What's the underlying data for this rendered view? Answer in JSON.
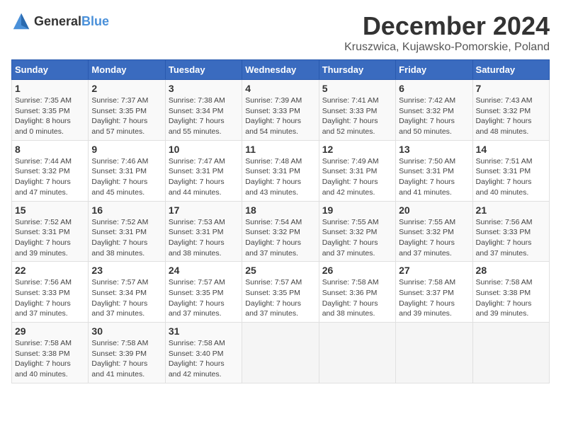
{
  "logo": {
    "text_general": "General",
    "text_blue": "Blue"
  },
  "title": "December 2024",
  "location": "Kruszwica, Kujawsko-Pomorskie, Poland",
  "weekdays": [
    "Sunday",
    "Monday",
    "Tuesday",
    "Wednesday",
    "Thursday",
    "Friday",
    "Saturday"
  ],
  "weeks": [
    [
      {
        "day": "1",
        "detail": "Sunrise: 7:35 AM\nSunset: 3:35 PM\nDaylight: 8 hours\nand 0 minutes."
      },
      {
        "day": "2",
        "detail": "Sunrise: 7:37 AM\nSunset: 3:35 PM\nDaylight: 7 hours\nand 57 minutes."
      },
      {
        "day": "3",
        "detail": "Sunrise: 7:38 AM\nSunset: 3:34 PM\nDaylight: 7 hours\nand 55 minutes."
      },
      {
        "day": "4",
        "detail": "Sunrise: 7:39 AM\nSunset: 3:33 PM\nDaylight: 7 hours\nand 54 minutes."
      },
      {
        "day": "5",
        "detail": "Sunrise: 7:41 AM\nSunset: 3:33 PM\nDaylight: 7 hours\nand 52 minutes."
      },
      {
        "day": "6",
        "detail": "Sunrise: 7:42 AM\nSunset: 3:32 PM\nDaylight: 7 hours\nand 50 minutes."
      },
      {
        "day": "7",
        "detail": "Sunrise: 7:43 AM\nSunset: 3:32 PM\nDaylight: 7 hours\nand 48 minutes."
      }
    ],
    [
      {
        "day": "8",
        "detail": "Sunrise: 7:44 AM\nSunset: 3:32 PM\nDaylight: 7 hours\nand 47 minutes."
      },
      {
        "day": "9",
        "detail": "Sunrise: 7:46 AM\nSunset: 3:31 PM\nDaylight: 7 hours\nand 45 minutes."
      },
      {
        "day": "10",
        "detail": "Sunrise: 7:47 AM\nSunset: 3:31 PM\nDaylight: 7 hours\nand 44 minutes."
      },
      {
        "day": "11",
        "detail": "Sunrise: 7:48 AM\nSunset: 3:31 PM\nDaylight: 7 hours\nand 43 minutes."
      },
      {
        "day": "12",
        "detail": "Sunrise: 7:49 AM\nSunset: 3:31 PM\nDaylight: 7 hours\nand 42 minutes."
      },
      {
        "day": "13",
        "detail": "Sunrise: 7:50 AM\nSunset: 3:31 PM\nDaylight: 7 hours\nand 41 minutes."
      },
      {
        "day": "14",
        "detail": "Sunrise: 7:51 AM\nSunset: 3:31 PM\nDaylight: 7 hours\nand 40 minutes."
      }
    ],
    [
      {
        "day": "15",
        "detail": "Sunrise: 7:52 AM\nSunset: 3:31 PM\nDaylight: 7 hours\nand 39 minutes."
      },
      {
        "day": "16",
        "detail": "Sunrise: 7:52 AM\nSunset: 3:31 PM\nDaylight: 7 hours\nand 38 minutes."
      },
      {
        "day": "17",
        "detail": "Sunrise: 7:53 AM\nSunset: 3:31 PM\nDaylight: 7 hours\nand 38 minutes."
      },
      {
        "day": "18",
        "detail": "Sunrise: 7:54 AM\nSunset: 3:32 PM\nDaylight: 7 hours\nand 37 minutes."
      },
      {
        "day": "19",
        "detail": "Sunrise: 7:55 AM\nSunset: 3:32 PM\nDaylight: 7 hours\nand 37 minutes."
      },
      {
        "day": "20",
        "detail": "Sunrise: 7:55 AM\nSunset: 3:32 PM\nDaylight: 7 hours\nand 37 minutes."
      },
      {
        "day": "21",
        "detail": "Sunrise: 7:56 AM\nSunset: 3:33 PM\nDaylight: 7 hours\nand 37 minutes."
      }
    ],
    [
      {
        "day": "22",
        "detail": "Sunrise: 7:56 AM\nSunset: 3:33 PM\nDaylight: 7 hours\nand 37 minutes."
      },
      {
        "day": "23",
        "detail": "Sunrise: 7:57 AM\nSunset: 3:34 PM\nDaylight: 7 hours\nand 37 minutes."
      },
      {
        "day": "24",
        "detail": "Sunrise: 7:57 AM\nSunset: 3:35 PM\nDaylight: 7 hours\nand 37 minutes."
      },
      {
        "day": "25",
        "detail": "Sunrise: 7:57 AM\nSunset: 3:35 PM\nDaylight: 7 hours\nand 37 minutes."
      },
      {
        "day": "26",
        "detail": "Sunrise: 7:58 AM\nSunset: 3:36 PM\nDaylight: 7 hours\nand 38 minutes."
      },
      {
        "day": "27",
        "detail": "Sunrise: 7:58 AM\nSunset: 3:37 PM\nDaylight: 7 hours\nand 39 minutes."
      },
      {
        "day": "28",
        "detail": "Sunrise: 7:58 AM\nSunset: 3:38 PM\nDaylight: 7 hours\nand 39 minutes."
      }
    ],
    [
      {
        "day": "29",
        "detail": "Sunrise: 7:58 AM\nSunset: 3:38 PM\nDaylight: 7 hours\nand 40 minutes."
      },
      {
        "day": "30",
        "detail": "Sunrise: 7:58 AM\nSunset: 3:39 PM\nDaylight: 7 hours\nand 41 minutes."
      },
      {
        "day": "31",
        "detail": "Sunrise: 7:58 AM\nSunset: 3:40 PM\nDaylight: 7 hours\nand 42 minutes."
      },
      {
        "day": "",
        "detail": ""
      },
      {
        "day": "",
        "detail": ""
      },
      {
        "day": "",
        "detail": ""
      },
      {
        "day": "",
        "detail": ""
      }
    ]
  ]
}
